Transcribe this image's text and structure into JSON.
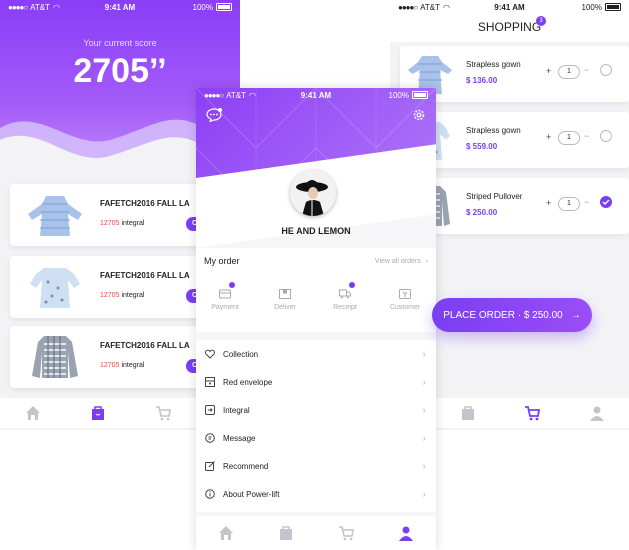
{
  "status": {
    "carrier": "AT&T",
    "time": "9:41 AM",
    "battery": "100%"
  },
  "left": {
    "score_label": "Your current score",
    "score_value": "2705’’",
    "products": [
      {
        "title": "FAFETCH2016 FALL LA",
        "points": "12705",
        "unit": "integral",
        "button": "CHA"
      },
      {
        "title": "FAFETCH2016 FALL LA",
        "points": "12705",
        "unit": "integral",
        "button": "CHA"
      },
      {
        "title": "FAFETCH2016 FALL LA",
        "points": "12705",
        "unit": "integral",
        "button": "CHA"
      }
    ],
    "tabs": [
      "home-icon",
      "bag-icon",
      "cart-icon"
    ]
  },
  "middle": {
    "username": "HE AND LEMON",
    "my_order": "My order",
    "view_all": "View all orders",
    "order_items": [
      {
        "label": "Payment",
        "icon": "payment-icon",
        "badge": true
      },
      {
        "label": "Deliver",
        "icon": "deliver-icon",
        "badge": false
      },
      {
        "label": "Receipt",
        "icon": "receipt-icon",
        "badge": true
      },
      {
        "label": "Customer",
        "icon": "customer-icon",
        "badge": false
      }
    ],
    "menu": [
      {
        "label": "Collection",
        "icon": "heart-icon"
      },
      {
        "label": "Red envelope",
        "icon": "envelope-icon"
      },
      {
        "label": "Integral",
        "icon": "integral-icon"
      },
      {
        "label": "Message",
        "icon": "message-icon"
      },
      {
        "label": "Recommend",
        "icon": "recommend-icon"
      },
      {
        "label": "About Power-lift",
        "icon": "info-icon"
      }
    ],
    "tabs": [
      "home-icon",
      "bag-icon",
      "cart-icon",
      "user-icon"
    ]
  },
  "right": {
    "title": "SHOPPING",
    "badge": "3",
    "items": [
      {
        "name": "Strapless gown",
        "price": "$ 136.00",
        "qty": "1",
        "checked": false
      },
      {
        "name": "Strapless gown",
        "price": "$ 559.00",
        "qty": "1",
        "checked": false
      },
      {
        "name": "Striped Pullover",
        "price": "$ 250.00",
        "qty": "1",
        "checked": true
      }
    ],
    "plus": "+",
    "minus": "−",
    "place_order": "PLACE ORDER · $ 250.00",
    "arrow": "→",
    "tabs": [
      "bag-icon",
      "cart-icon",
      "user-icon"
    ]
  },
  "colors": {
    "accent": "#7a3ef2",
    "red": "#e74848"
  }
}
